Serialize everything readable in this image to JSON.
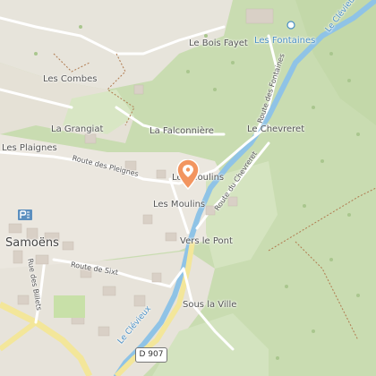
{
  "map": {
    "labels": {
      "le_bois_fayet": "Le Bois Fayet",
      "les_fontaines": "Les Fontaines",
      "le_clevieux_top": "Le Clévieux",
      "les_combes": "Les Combes",
      "la_grangiat": "La Grangiat",
      "la_falconniere": "La Falconnière",
      "le_chevreret": "Le Chevreret",
      "les_plaignes": "Les Plaignes",
      "route_des_fontaines": "Route des Fontaines",
      "route_des_pleignes": "Route des Pleignes",
      "route_du_chevreret": "Route du Chevreret",
      "les_moulins_top": "Les Moulins",
      "les_moulins": "Les Moulins",
      "samoens": "Samoëns",
      "vers_le_pont": "Vers le Pont",
      "route_de_sixt": "Route de Sixt",
      "rue_des_billets": "Rue des Billets",
      "sous_la_ville": "Sous la Ville",
      "le_clevieux_bottom": "Le Clévieux",
      "road_shield": "D 907"
    },
    "icons": {
      "marker": "map-pin-icon",
      "viewpoint": "viewpoint-icon",
      "parking": "parking-icon"
    },
    "colors": {
      "forest": "#c9dcb1",
      "meadow": "#d6e5c2",
      "river": "#8fc3e6",
      "road_major": "#f3e69a",
      "marker": "#f29560"
    }
  }
}
